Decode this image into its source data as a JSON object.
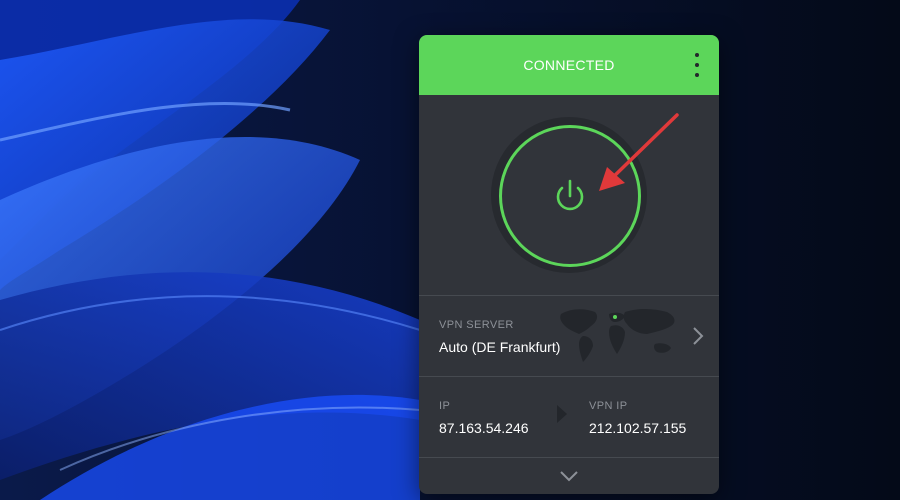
{
  "desktop": {
    "wallpaper": "blue-abstract-waves"
  },
  "vpn": {
    "status": "CONNECTED",
    "accent_color": "#5cd65a",
    "menu_icon": "more-vertical-icon",
    "power_icon": "power-icon",
    "server": {
      "label": "VPN SERVER",
      "value": "Auto (DE Frankfurt)",
      "map_icon": "world-map",
      "chevron_icon": "chevron-right-icon"
    },
    "ip": {
      "label": "IP",
      "value": "87.163.54.246"
    },
    "vpn_ip": {
      "label": "VPN IP",
      "value": "212.102.57.155"
    },
    "expand_icon": "chevron-down-icon"
  },
  "annotation": {
    "arrow_color": "#e0393a"
  }
}
